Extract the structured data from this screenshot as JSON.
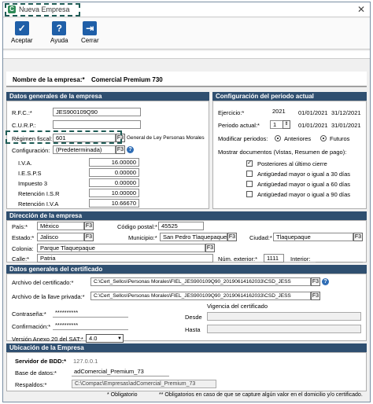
{
  "window": {
    "title": "Nueva Empresa",
    "close": "✕"
  },
  "toolbar": {
    "accept": "Aceptar",
    "help": "Ayuda",
    "close": "Cerrar"
  },
  "company": {
    "label": "Nombre de la empresa:*",
    "value": "Comercial Premium 730"
  },
  "general": {
    "section": "Datos generales de la empresa",
    "rfc_label": "R.F.C.:*",
    "rfc": "JES900109Q90",
    "curp_label": "C.U.R.P.:",
    "regimen_label": "Régimen fiscal:",
    "regimen_code": "601",
    "regimen_desc": "General de Ley Personas Morales",
    "config_label": "Configuración:",
    "config_value": "(Predeterminada)",
    "taxes": [
      {
        "label": "I.V.A.",
        "value": "16.00000"
      },
      {
        "label": "I.E.S.P.S",
        "value": "0.00000"
      },
      {
        "label": "Impuesto 3",
        "value": "0.00000"
      },
      {
        "label": "Retención I.S.R",
        "value": "10.00000"
      },
      {
        "label": "Retención I.V.A",
        "value": "10.66670"
      }
    ]
  },
  "period": {
    "section": "Configuración del periodo actual",
    "ejercicio_label": "Ejercicio:*",
    "ejercicio": "2021",
    "ej_start": "01/01/2021",
    "ej_end": "31/12/2021",
    "periodo_label": "Periodo actual:*",
    "periodo": "1",
    "p_start": "01/01/2021",
    "p_end": "31/01/2021",
    "modify_label": "Modificar periodos:",
    "prev": "Anteriores",
    "future": "Futuros",
    "show_label": "Mostrar documentos (Vistas, Resumen de pago):",
    "options": [
      {
        "label": "Posteriores al último cierre",
        "checked": true
      },
      {
        "label": "Antigüedad mayor o igual a 30 días",
        "checked": false
      },
      {
        "label": "Antigüedad mayor o igual a 60 días",
        "checked": false
      },
      {
        "label": "Antigüedad mayor o igual a 90 días",
        "checked": false
      }
    ]
  },
  "address": {
    "section": "Dirección de la empresa",
    "pais_label": "País:*",
    "pais": "México",
    "cp_label": "Código postal:*",
    "cp": "45525",
    "estado_label": "Estado:*",
    "estado": "Jalisco",
    "municipio_label": "Municipio:*",
    "municipio": "San Pedro Tlaquepaque",
    "ciudad_label": "Ciudad:*",
    "ciudad": "Tlaquepaque",
    "colonia_label": "Colonia:",
    "colonia": "Parque Tlaquepaque",
    "calle_label": "Calle:*",
    "calle": "Patria",
    "ext_label": "Núm. exterior:*",
    "ext": "1111",
    "int_label": "Interior:"
  },
  "cert": {
    "section": "Datos generales del certificado",
    "cert_label": "Archivo del certificado:*",
    "cert_path": "C:\\Cert_Sellos\\Personas Morales\\FIEL_JES900109Q90_20190614162033\\CSD_JESS",
    "key_label": "Archivo de la llave privada:*",
    "key_path": "C:\\Cert_Sellos\\Personas Morales\\FIEL_JES900109Q90_20190614162033\\CSD_JESS",
    "validity_label": "Vigencia del certificado",
    "pass_label": "Contraseña:*",
    "pass": "**********",
    "confirm_label": "Confirmación:*",
    "confirm": "**********",
    "from_label": "Desde",
    "to_label": "Hasta",
    "sat_label": "Versión Anexo 20 del SAT:*",
    "sat": "4.0"
  },
  "location": {
    "section": "Ubicación de la Empresa",
    "server_label": "Servidor de BDD:*",
    "server": "127.0.0.1",
    "db_label": "Base de datos:*",
    "db": "adComercial_Premium_73",
    "backup_label": "Respaldos:*",
    "backup": "C:\\Compac\\Empresas\\adComercial_Premium_73"
  },
  "footer": {
    "required": "* Obligatorio",
    "conditional": "** Obligatorios en caso de que se capture algún valor en el domicilio y/o certificado."
  }
}
